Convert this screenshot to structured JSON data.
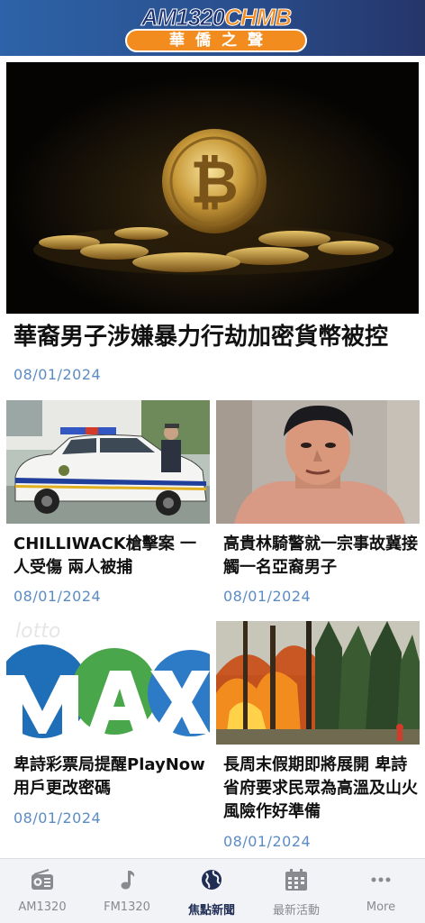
{
  "header": {
    "logo_am": "AM1320",
    "logo_chmb": "CHMB",
    "logo_chinese": "華僑之聲"
  },
  "featured": {
    "title": "華裔男子涉嫌暴力行劫加密貨幣被控",
    "date": "08/01/2024",
    "image": "bitcoin-coins"
  },
  "articles": [
    {
      "title": "CHILLIWACK槍擊案 一人受傷 兩人被捕",
      "date": "08/01/2024",
      "image": "police-car"
    },
    {
      "title": "高貴林騎警就一宗事故冀接觸一名亞裔男子",
      "date": "08/01/2024",
      "image": "man-portrait"
    },
    {
      "title": "卑詩彩票局提醒PlayNow用戶更改密碼",
      "date": "08/01/2024",
      "image": "lotto-max-logo"
    },
    {
      "title": "長周末假期即將展開 卑詩省府要求民眾為高溫及山火風險作好準備",
      "date": "08/01/2024",
      "image": "forest-fire"
    }
  ],
  "tabs": [
    {
      "label": "AM1320",
      "icon": "radio-icon",
      "active": false
    },
    {
      "label": "FM1320",
      "icon": "music-note-icon",
      "active": false
    },
    {
      "label": "焦點新聞",
      "icon": "globe-icon",
      "active": true
    },
    {
      "label": "最新活動",
      "icon": "calendar-icon",
      "active": false
    },
    {
      "label": "More",
      "icon": "more-dots-icon",
      "active": false
    }
  ],
  "colors": {
    "header_blue": "#2a4f8e",
    "logo_orange": "#f28c1f",
    "date_blue": "#5b8cc4",
    "tab_active": "#1f2d55",
    "tab_inactive": "#888a90"
  }
}
